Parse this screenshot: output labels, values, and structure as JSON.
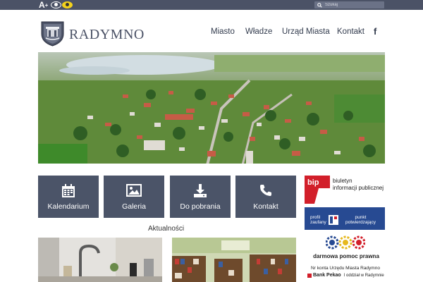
{
  "topbar": {
    "font_size_label": "A",
    "font_size_sup": "+",
    "contrast_icon": "eye-icon",
    "high_contrast_icon": "eye-yellow-icon",
    "search_placeholder": "Szukaj"
  },
  "header": {
    "site_title": "RADYMNO",
    "nav": [
      "Miasto",
      "Władze",
      "Urząd Miasta",
      "Kontakt"
    ],
    "facebook_label": "f"
  },
  "tiles": [
    {
      "label": "Kalendarium",
      "icon": "calendar-icon"
    },
    {
      "label": "Galeria",
      "icon": "image-icon"
    },
    {
      "label": "Do pobrania",
      "icon": "download-icon"
    },
    {
      "label": "Kontakt",
      "icon": "phone-icon"
    }
  ],
  "news": {
    "heading": "Aktualności"
  },
  "sidebar": {
    "bip_logo": "bip",
    "bip_text_line1": "biuletyn",
    "bip_text_line2": "informacji publicznej",
    "profil_left_1": "profil",
    "profil_left_2": "zaufany",
    "profil_right_1": "punkt",
    "profil_right_2": "potwierdzający",
    "pomoc_text": "darmowa pomoc prawna",
    "bank_line1": "Nr konta Urzędu Miasta Radymno",
    "bank_name": "Bank Pekao",
    "bank_branch": "I oddział w Radymnie"
  },
  "colors": {
    "topbar": "#4b5266",
    "tile": "#4b5468",
    "nav_text": "#333c4e",
    "bip_red": "#d21f2a",
    "profil_blue": "#274a92"
  }
}
